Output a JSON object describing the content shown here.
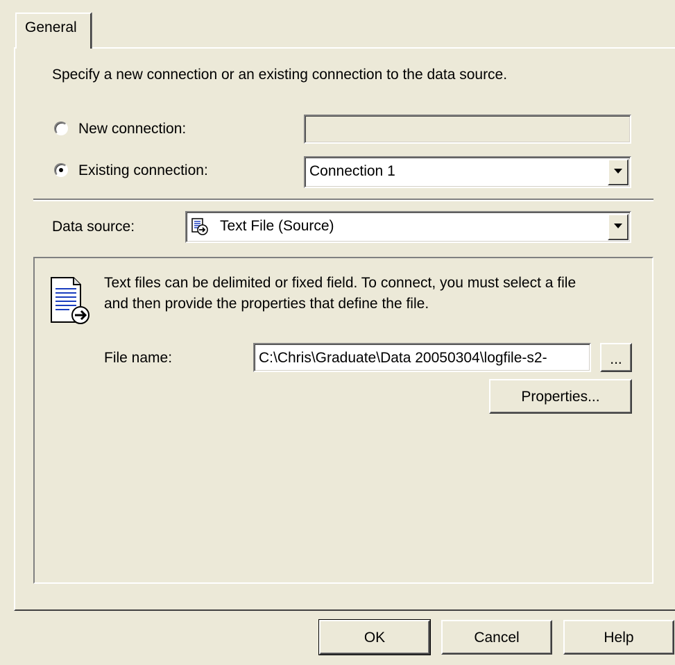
{
  "tab": {
    "label": "General"
  },
  "intro": "Specify a new connection or an existing connection to the data source.",
  "connection": {
    "new_label": "New connection:",
    "new_value": "",
    "existing_label": "Existing connection:",
    "existing_value": "Connection 1",
    "selected": "existing"
  },
  "data_source": {
    "label": "Data source:",
    "value": "Text File (Source)",
    "icon": "text-file-source-icon"
  },
  "description": {
    "icon": "text-file-icon",
    "line1": "Text files can be delimited or fixed field. To connect, you must select a file",
    "line2": "and then provide the properties that define the file."
  },
  "file": {
    "label": "File name:",
    "value": "C:\\Chris\\Graduate\\Data 20050304\\logfile-s2-",
    "browse_label": "...",
    "properties_label": "Properties..."
  },
  "footer": {
    "ok_label": "OK",
    "cancel_label": "Cancel",
    "help_label": "Help"
  }
}
